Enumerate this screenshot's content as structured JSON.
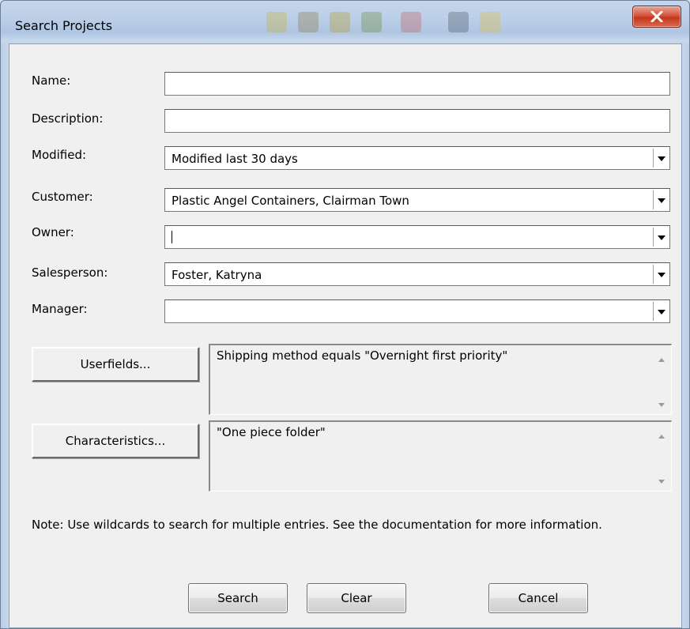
{
  "window": {
    "title": "Search Projects"
  },
  "form": {
    "name": {
      "label": "Name:",
      "value": ""
    },
    "description": {
      "label": "Description:",
      "value": ""
    },
    "modified": {
      "label": "Modified:",
      "value": "Modified last 30 days"
    },
    "customer": {
      "label": "Customer:",
      "value": "Plastic Angel Containers, Clairman Town"
    },
    "owner": {
      "label": "Owner:",
      "value": ""
    },
    "salesperson": {
      "label": "Salesperson:",
      "value": "Foster, Katryna"
    },
    "manager": {
      "label": "Manager:",
      "value": ""
    }
  },
  "userfields": {
    "button_label": "Userfields...",
    "text": "Shipping method equals \"Overnight first priority\""
  },
  "characteristics": {
    "button_label": "Characteristics...",
    "text": "\"One piece folder\""
  },
  "note": "Note: Use wildcards to search for multiple entries. See the documentation for more information.",
  "buttons": {
    "search": "Search",
    "clear": "Clear",
    "cancel": "Cancel"
  },
  "icons": {
    "close": "close-icon",
    "dropdown": "chevron-down-icon",
    "scroll_up": "scroll-up-icon",
    "scroll_down": "scroll-down-icon"
  },
  "colors": {
    "close_button": "#c5361f",
    "dialog_bg": "#f0f0f0",
    "title_bar": "#bdd0e8"
  }
}
